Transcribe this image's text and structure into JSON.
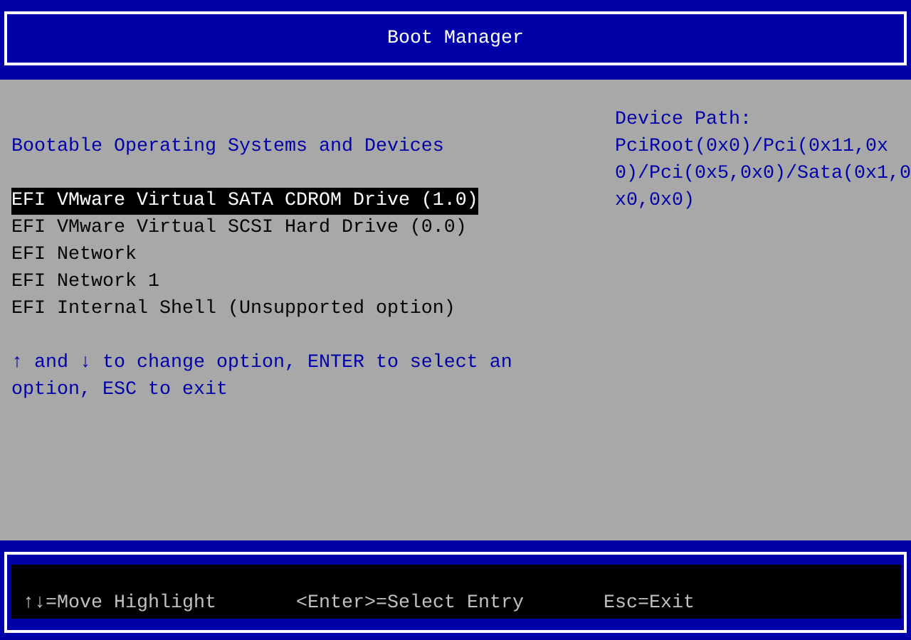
{
  "window": {
    "title": "Boot Manager"
  },
  "section_title": "Bootable Operating Systems and Devices",
  "boot_options": [
    {
      "label": "EFI VMware Virtual SATA CDROM Drive (1.0)",
      "selected": true
    },
    {
      "label": "EFI VMware Virtual SCSI Hard Drive (0.0)",
      "selected": false
    },
    {
      "label": "EFI Network",
      "selected": false
    },
    {
      "label": "EFI Network 1",
      "selected": false
    },
    {
      "label": "EFI Internal Shell (Unsupported option)",
      "selected": false
    }
  ],
  "help_text": "↑ and ↓ to change option, ENTER to select an option, ESC to exit",
  "device_path": {
    "label": "Device Path:",
    "value": "PciRoot(0x0)/Pci(0x11,0x0)/Pci(0x5,0x0)/Sata(0x1,0x0,0x0)"
  },
  "status_bar": [
    "↑↓=Move Highlight",
    "<Enter>=Select Entry",
    "Esc=Exit"
  ]
}
